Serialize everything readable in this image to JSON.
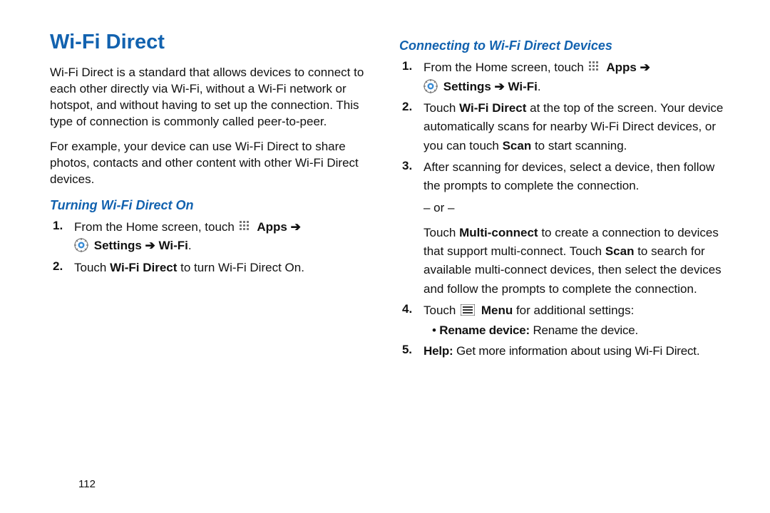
{
  "page_number": "112",
  "title": "Wi-Fi Direct",
  "intro1": "Wi-Fi Direct is a standard that allows devices to connect to each other directly via Wi-Fi, without a Wi-Fi network or hotspot, and without having to set up the connection. This type of connection is commonly called peer-to-peer.",
  "intro2": "For example, your device can use Wi-Fi Direct to share photos, contacts and other content with other Wi-Fi Direct devices.",
  "sec1": {
    "heading": "Turning Wi-Fi Direct On",
    "step1_pre": "From the Home screen, touch ",
    "apps": "Apps",
    "settings": "Settings",
    "wifi": "Wi-Fi",
    "step2_pre": "Touch ",
    "step2_bold": "Wi-Fi Direct",
    "step2_post": " to turn Wi-Fi Direct On."
  },
  "sec2": {
    "heading": "Connecting to Wi-Fi Direct Devices",
    "step1_pre": "From the Home screen, touch ",
    "apps": "Apps",
    "settings": "Settings",
    "wifi": "Wi-Fi",
    "step2_pre": "Touch ",
    "step2_b1": "Wi-Fi Direct",
    "step2_mid": " at the top of the screen. Your device automatically scans for nearby Wi-Fi Direct devices, or you can touch ",
    "step2_b2": "Scan",
    "step2_post": " to start scanning.",
    "step3": "After scanning for devices, select a device, then follow the prompts to complete the connection.",
    "or": "– or –",
    "step3b_pre": "Touch ",
    "step3b_b1": "Multi-connect",
    "step3b_mid": " to create a connection to devices that support multi-connect. Touch ",
    "step3b_b2": "Scan",
    "step3b_post": " to search for available multi-connect devices, then select the devices and follow the prompts to complete the connection.",
    "step4_pre": "Touch ",
    "step4_menu": "Menu",
    "step4_post": " for additional settings:",
    "step4_sub_b": "Rename device:",
    "step4_sub_t": " Rename the device.",
    "step5_b": "Help:",
    "step5_t": " Get more information about using Wi-Fi Direct."
  },
  "arrow": " ➔ "
}
